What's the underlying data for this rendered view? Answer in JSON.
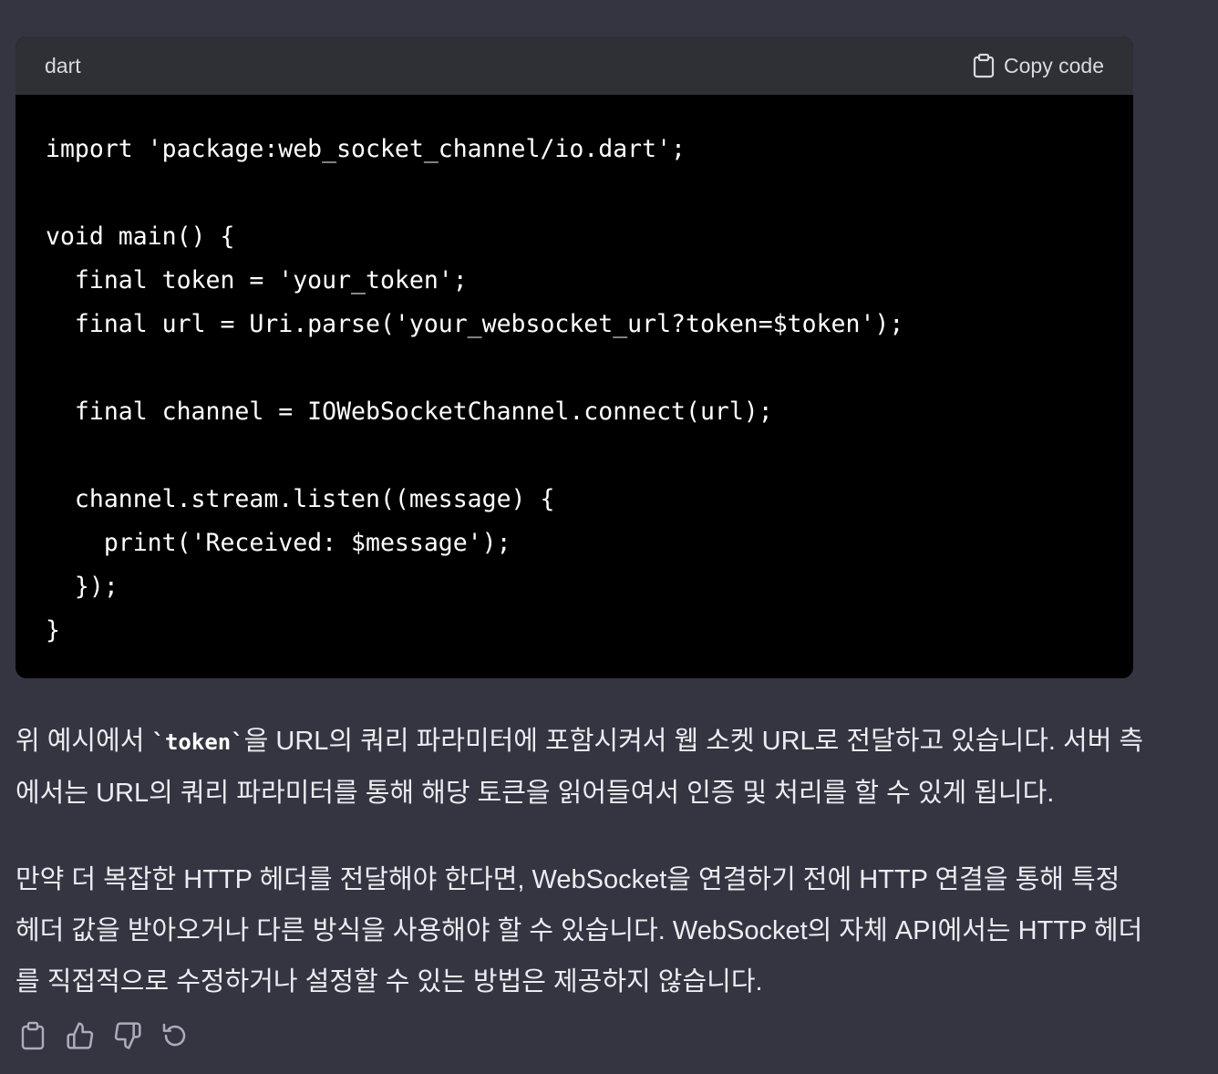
{
  "code_block": {
    "language": "dart",
    "copy_label": "Copy code",
    "lines": [
      "import 'package:web_socket_channel/io.dart';",
      "",
      "void main() {",
      "  final token = 'your_token';",
      "  final url = Uri.parse('your_websocket_url?token=$token');",
      "",
      "  final channel = IOWebSocketChannel.connect(url);",
      "",
      "  channel.stream.listen((message) {",
      "    print('Received: $message');",
      "  });",
      "}"
    ]
  },
  "paragraph1": {
    "before_code": "위 예시에서 ",
    "inline_code": "`token`",
    "after_code": "을 URL의 쿼리 파라미터에 포함시켜서 웹 소켓 URL로 전달하고 있습니다. 서버 측에서는 URL의 쿼리 파라미터를 통해 해당 토큰을 읽어들여서 인증 및 처리를 할 수 있게 됩니다."
  },
  "paragraph2": {
    "text": "만약 더 복잡한 HTTP 헤더를 전달해야 한다면, WebSocket을 연결하기 전에 HTTP 연결을 통해 특정 헤더 값을 받아오거나 다른 방식을 사용해야 할 수 있습니다. WebSocket의 자체 API에서는 HTTP 헤더를 직접적으로 수정하거나 설정할 수 있는 방법은 제공하지 않습니다."
  },
  "actions": {
    "icons": [
      "clipboard-icon",
      "thumbs-up-icon",
      "thumbs-down-icon",
      "regenerate-icon"
    ]
  },
  "colors": {
    "background": "#343541",
    "code_background": "#000000",
    "code_header": "#2f2f36",
    "text": "#ececf1"
  }
}
